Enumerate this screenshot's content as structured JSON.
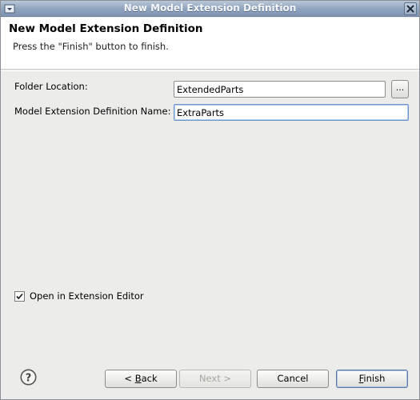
{
  "window": {
    "title": "New Model Extension Definition"
  },
  "banner": {
    "title": "New Model Extension Definition",
    "message": "Press the \"Finish\" button to finish."
  },
  "form": {
    "folder_location": {
      "label": "Folder Location:",
      "value": "ExtendedParts"
    },
    "browse_button": {
      "label": "..."
    },
    "definition_name": {
      "label": "Model Extension Definition Name:",
      "value": "ExtraParts"
    },
    "open_in_editor": {
      "label": "Open in Extension Editor",
      "checked": true
    }
  },
  "buttons": {
    "back": {
      "prefix": "< ",
      "mnemonic": "B",
      "rest": "ack"
    },
    "next": {
      "label": "Next >",
      "enabled": false
    },
    "cancel": {
      "label": "Cancel"
    },
    "finish": {
      "mnemonic": "F",
      "rest": "inish"
    }
  },
  "icons": {
    "system_menu": "window-menu-icon",
    "close": "close-icon",
    "help": "help-icon",
    "checkmark": "checkmark-icon"
  },
  "colors": {
    "titlebar": "#8fa3bd",
    "dialog_background": "#ececeb",
    "focus_border": "#6b95c8",
    "default_button_border": "#5d7aa6"
  }
}
